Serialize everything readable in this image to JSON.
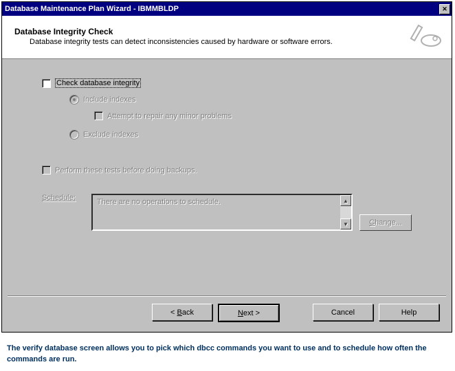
{
  "titlebar": "Database Maintenance Plan Wizard - IBMMBLDP",
  "header": {
    "title": "Database Integrity Check",
    "subtitle": "Database integrity tests can detect inconsistencies caused by hardware or software errors."
  },
  "options": {
    "check_integrity": "Check database integrity",
    "include_indexes": "Include indexes",
    "attempt_repair": "Attempt to repair any minor problems",
    "exclude_indexes": "Exclude indexes",
    "perform_before_backup": "Perform these tests before doing backups."
  },
  "schedule": {
    "label": "Schedule:",
    "text": "There are no operations to schedule.",
    "change": "Change..."
  },
  "buttons": {
    "back": "< Back",
    "next": "Next >",
    "cancel": "Cancel",
    "help": "Help"
  },
  "caption": "The verify database screen  allows you to pick which dbcc commands you want to use and to schedule how often the commands are run."
}
